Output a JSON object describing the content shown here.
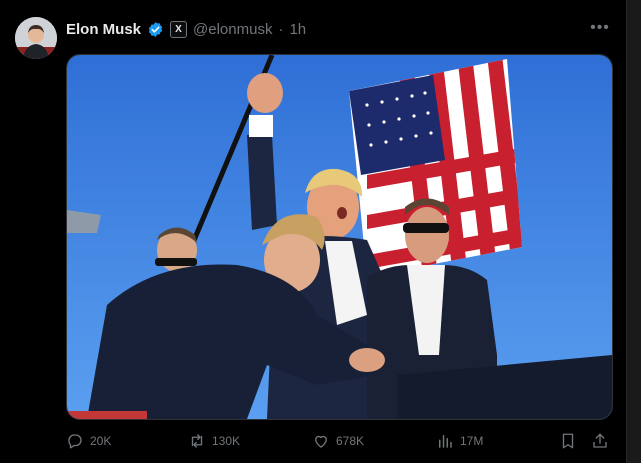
{
  "tweet": {
    "author_name": "Elon Musk",
    "x_badge": "X",
    "handle": "@elonmusk",
    "separator": "·",
    "time": "1h",
    "more_label": "•••"
  },
  "actions": {
    "replies": "20K",
    "reposts": "130K",
    "likes": "678K",
    "views": "17M"
  },
  "colors": {
    "background": "#000000",
    "verified": "#1d9bf0",
    "muted_text": "#71767b",
    "primary_text": "#e7e9ea"
  },
  "icons": [
    "reply-icon",
    "repost-icon",
    "like-icon",
    "views-icon",
    "bookmark-icon",
    "share-icon",
    "verified-badge-icon",
    "more-icon"
  ]
}
